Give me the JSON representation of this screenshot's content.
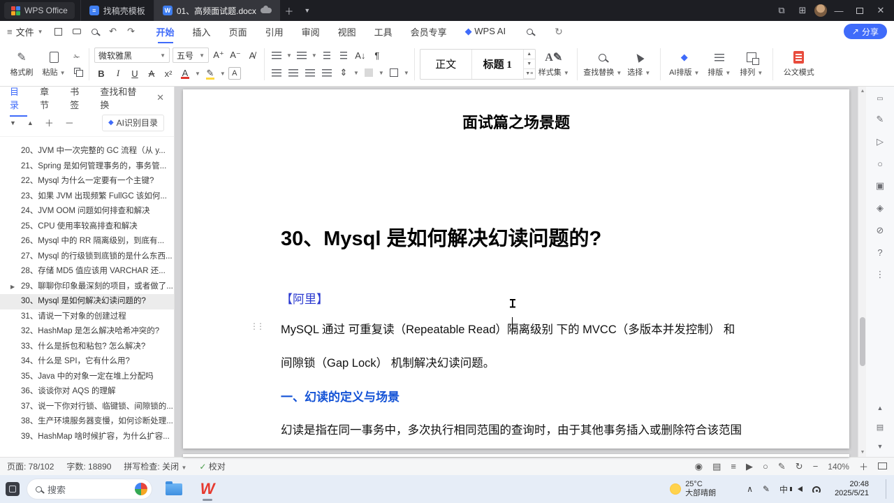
{
  "titlebar": {
    "home": "WPS Office",
    "tab_template": "找稿壳模板",
    "tab_doc": "01、高频面试题.docx"
  },
  "menubar": {
    "file": "文件",
    "tabs": [
      "开始",
      "插入",
      "页面",
      "引用",
      "审阅",
      "视图",
      "工具",
      "会员专享",
      "WPS AI"
    ],
    "share": "分享"
  },
  "ribbon": {
    "format_painter": "格式刷",
    "paste": "粘贴",
    "font_name": "微软雅黑",
    "font_size": "五号",
    "bold": "B",
    "italic": "I",
    "underline": "U",
    "style_normal": "正文",
    "style_heading": "标题 1",
    "style_set": "样式集",
    "find_replace": "查找替换",
    "select": "选择",
    "ai_layout": "AI排版",
    "layout": "排版",
    "arrange": "排列",
    "official_mode": "公文模式"
  },
  "sidebar": {
    "tabs": [
      "目录",
      "章节",
      "书签",
      "查找和替换"
    ],
    "ai_recognize": "AI识别目录",
    "items": [
      {
        "label": "20、JVM 中一次完整的 GC 流程（从 y..."
      },
      {
        "label": "21、Spring 是如何管理事务的，事务管..."
      },
      {
        "label": "22、Mysql 为什么一定要有一个主键?"
      },
      {
        "label": "23、如果 JVM 出现频繁 FullGC 该如何..."
      },
      {
        "label": "24、JVM OOM 问题如何排查和解决"
      },
      {
        "label": "25、CPU 使用率较高排查和解决"
      },
      {
        "label": "26、Mysql 中的 RR 隔离级别，到底有..."
      },
      {
        "label": "27、Mysql 的行级锁到底锁的是什么东西..."
      },
      {
        "label": "28、存储 MD5 值应该用 VARCHAR 还..."
      },
      {
        "label": "29、聊聊你印象最深刻的项目，或者做了...",
        "expandable": true
      },
      {
        "label": "30、Mysql 是如何解决幻读问题的?",
        "selected": true
      },
      {
        "label": "31、请说一下对象的创建过程"
      },
      {
        "label": "32、HashMap 是怎么解决哈希冲突的?"
      },
      {
        "label": "33、什么是拆包和粘包? 怎么解决?"
      },
      {
        "label": "34、什么是 SPI，它有什么用?"
      },
      {
        "label": "35、Java 中的对象一定在堆上分配吗"
      },
      {
        "label": "36、谈谈你对 AQS 的理解"
      },
      {
        "label": "37、说一下你对行锁、临键锁、间隙锁的..."
      },
      {
        "label": "38、生产环境服务器变慢，如何诊断处理..."
      },
      {
        "label": "39、HashMap 啥时候扩容，为什么扩容..."
      }
    ]
  },
  "document": {
    "page_title": "面试篇之场景题",
    "heading": "30、Mysql 是如何解决幻读问题的?",
    "source_tag": "【阿里】",
    "para_line1": "MySQL 通过 可重复读（Repeatable Read）隔离级别 下的 MVCC（多版本并发控制） 和",
    "para_line2": "间隙锁（Gap Lock） 机制解决幻读问题。",
    "section_heading": "一、幻读的定义与场景",
    "para2": "幻读是指在同一事务中，多次执行相同范围的查询时，由于其他事务插入或删除符合该范围"
  },
  "statusbar": {
    "page": "页面: 78/102",
    "words": "字数: 18890",
    "spellcheck": "拼写检查: 关闭",
    "proofread": "校对",
    "zoom": "140%"
  },
  "taskbar": {
    "search_placeholder": "搜索",
    "weather_temp": "25°C",
    "weather_desc": "大部晴朗",
    "ime": "中",
    "time": "20:48",
    "date": "2025/5/21"
  },
  "colors": {
    "accent_blue": "#3f6bfa",
    "doc_blue": "#2b3ad0",
    "wps_red": "#e6392f"
  }
}
